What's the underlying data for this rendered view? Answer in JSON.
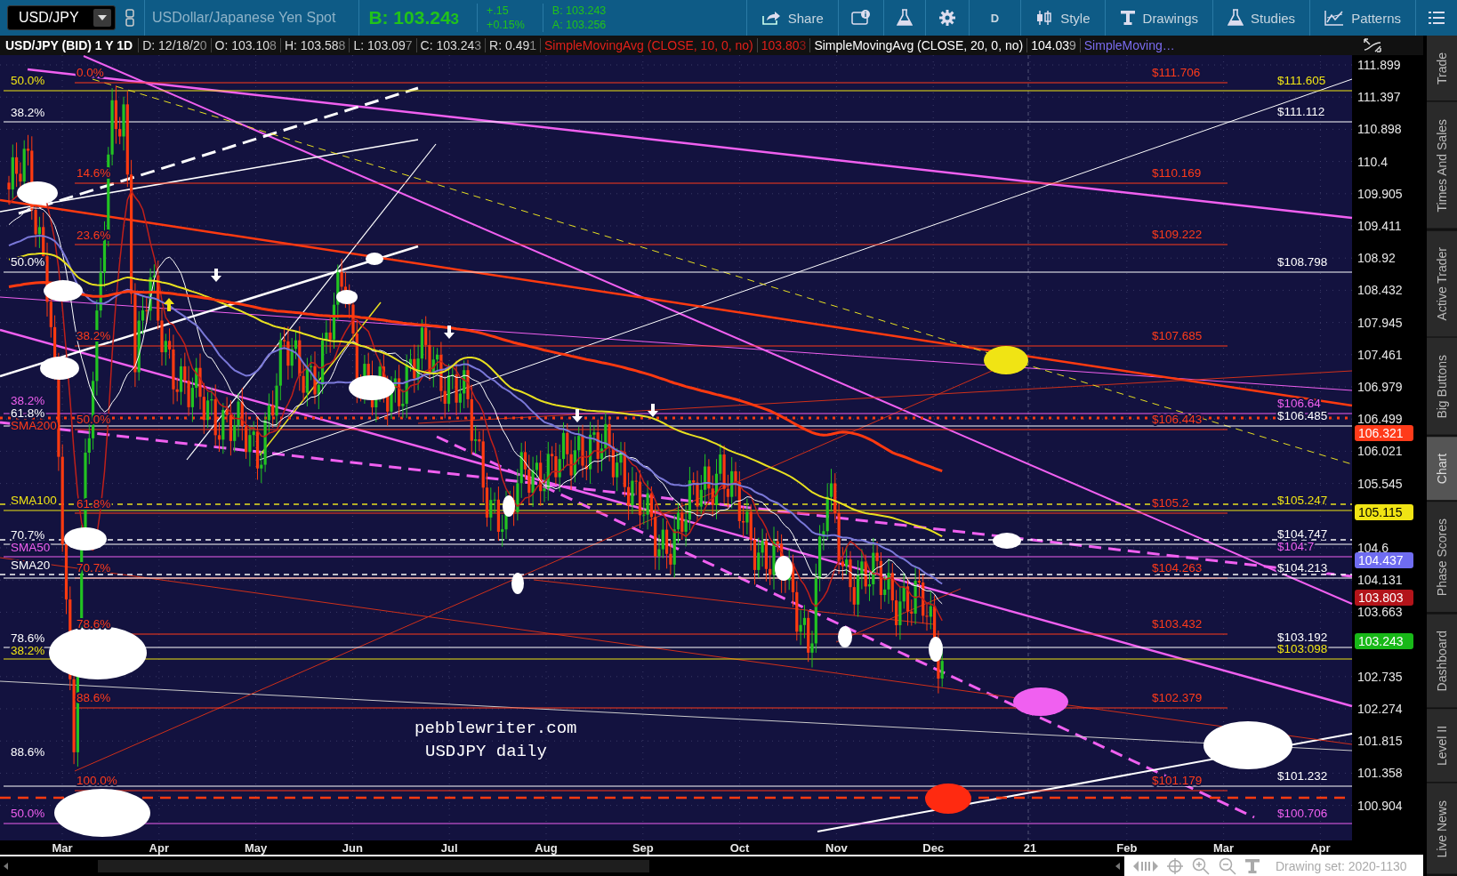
{
  "toolbar": {
    "symbol": "USD/JPY",
    "description": "USDollar/Japanese Yen Spot",
    "bid_big": "B: 103.243",
    "change": "+.15",
    "change_pct": "+0.15%",
    "bid": "B: 103.243",
    "ask": "A: 103.256",
    "buttons": [
      {
        "label": "Share"
      },
      {
        "label": "D"
      },
      {
        "label": "Style"
      },
      {
        "label": "Drawings"
      },
      {
        "label": "Studies"
      },
      {
        "label": "Patterns"
      }
    ]
  },
  "info_bar": {
    "title": "USD/JPY (BID) 1 Y 1D",
    "fields": [
      "D: 12/18/20",
      "O: 103.108",
      "H: 103.588",
      "L: 103.097",
      "C: 103.243",
      "R: 0.491"
    ],
    "studies": [
      {
        "label": "SimpleMovingAvg (CLOSE, 10, 0, no)",
        "value": "103.803",
        "color": "#e0201a"
      },
      {
        "label": "SimpleMovingAvg (CLOSE, 20, 0, no)",
        "value": "104.039",
        "color": "#ffffff"
      },
      {
        "label": "SimpleMoving…",
        "color": "#7b6cf0"
      }
    ]
  },
  "chart": {
    "level_labels": [
      {
        "text": "$111.706",
        "color": "#ff3b1a",
        "kind": "fib_level"
      },
      {
        "text": "$111.605",
        "color": "#f0e414",
        "kind": "line_level"
      },
      {
        "text": "$111.112",
        "color": "#ffffff",
        "kind": "line_level"
      },
      {
        "text": "$110.169",
        "color": "#ff3b1a",
        "kind": "fib_level"
      },
      {
        "text": "$109.222",
        "color": "#ff3b1a",
        "kind": "fib_level"
      },
      {
        "text": "$108.798",
        "color": "#ffffff",
        "kind": "line_level"
      },
      {
        "text": "$107.685",
        "color": "#ff3b1a",
        "kind": "fib_level"
      },
      {
        "text": "$106.64",
        "color": "#f060f0",
        "kind": "line_level"
      },
      {
        "text": "$106.443",
        "color": "#ff3b1a",
        "kind": "fib_level"
      },
      {
        "text": "$106.485",
        "color": "#ffffff",
        "kind": "line_level"
      },
      {
        "text": "$105.2",
        "color": "#ff3b1a",
        "kind": "fib_level"
      },
      {
        "text": "$105.247",
        "color": "#f0e414",
        "kind": "line_level"
      },
      {
        "text": "$104.747",
        "color": "#ffffff",
        "kind": "line_level"
      },
      {
        "text": "$104.7",
        "color": "#f060f0",
        "kind": "line_level"
      },
      {
        "text": "$104.263",
        "color": "#ff3b1a",
        "kind": "fib_level"
      },
      {
        "text": "$104.213",
        "color": "#ffffff",
        "kind": "line_level"
      },
      {
        "text": "$103.432",
        "color": "#ff3b1a",
        "kind": "fib_level"
      },
      {
        "text": "$103.192",
        "color": "#ffffff",
        "kind": "line_level"
      },
      {
        "text": "$103.098",
        "color": "#f0e414",
        "kind": "line_level"
      },
      {
        "text": "$102.379",
        "color": "#ff3b1a",
        "kind": "fib_level"
      },
      {
        "text": "$101.179",
        "color": "#ff3b1a",
        "kind": "fib_level"
      },
      {
        "text": "$101.232",
        "color": "#ffffff",
        "kind": "line_level"
      },
      {
        "text": "$100.706",
        "color": "#f060f0",
        "kind": "line_level"
      }
    ],
    "fib_labels": [
      {
        "text": "50.0%",
        "color": "#f0e414",
        "kind": "line_level"
      },
      {
        "text": "0.0%",
        "color": "#ff3b1a",
        "kind": "fib_level"
      },
      {
        "text": "38.2%",
        "color": "#ffffff",
        "kind": "line_level"
      },
      {
        "text": "14.6%",
        "color": "#ff3b1a",
        "kind": "fib_level"
      },
      {
        "text": "23.6%",
        "color": "#ff3b1a",
        "kind": "fib_level"
      },
      {
        "text": "50.0%",
        "color": "#ffffff",
        "kind": "line_level"
      },
      {
        "text": "38.2%",
        "color": "#ff3b1a",
        "kind": "fib_level"
      },
      {
        "text": "38.2%",
        "color": "#f060f0",
        "kind": "line_level"
      },
      {
        "text": "61.8%",
        "color": "#ffffff",
        "kind": "line_level"
      },
      {
        "text": "SMA200",
        "color": "#ff3b1a",
        "kind": "study"
      },
      {
        "text": "50.0%",
        "color": "#ff3b1a",
        "kind": "fib_level"
      },
      {
        "text": "SMA100",
        "color": "#f0e414",
        "kind": "study"
      },
      {
        "text": "61.8%",
        "color": "#ff3b1a",
        "kind": "fib_level"
      },
      {
        "text": "70.7%",
        "color": "#ffffff",
        "kind": "line_level"
      },
      {
        "text": "SMA50",
        "color": "#f060f0",
        "kind": "study"
      },
      {
        "text": "70.7%",
        "color": "#ff3b1a",
        "kind": "fib_level"
      },
      {
        "text": "SMA20",
        "color": "#ffffff",
        "kind": "study"
      },
      {
        "text": "78.6%",
        "color": "#ff3b1a",
        "kind": "fib_level"
      },
      {
        "text": "78.6%",
        "color": "#ffffff",
        "kind": "line_level"
      },
      {
        "text": "38.2%",
        "color": "#f0e414",
        "kind": "line_level"
      },
      {
        "text": "88.6%",
        "color": "#ff3b1a",
        "kind": "fib_level"
      },
      {
        "text": "88.6%",
        "color": "#ffffff",
        "kind": "line_level"
      },
      {
        "text": "100.0%",
        "color": "#ff3b1a",
        "kind": "fib_level"
      },
      {
        "text": "50.0%",
        "color": "#f060f0",
        "kind": "line_level"
      }
    ],
    "note": [
      "pebblewriter.com",
      "USDJPY daily"
    ],
    "price_axis": [
      "111.899",
      "111.397",
      "110.898",
      "110.4",
      "109.905",
      "109.411",
      "108.92",
      "108.432",
      "107.945",
      "107.461",
      "106.979",
      "106.499",
      "106.021",
      "105.545",
      "104.6",
      "104.131",
      "103.663",
      "102.735",
      "102.274",
      "101.815",
      "101.358",
      "100.904"
    ],
    "price_badges": [
      {
        "text": "106.321",
        "color": "#ff3b1a"
      },
      {
        "text": "105.115",
        "color": "#f0e414"
      },
      {
        "text": "104.437",
        "color": "#6f6cf0"
      },
      {
        "text": "103.803",
        "color": "#b3141a"
      },
      {
        "text": "103.243",
        "color": "#18b818"
      }
    ],
    "months": [
      "Mar",
      "Apr",
      "May",
      "Jun",
      "Jul",
      "Aug",
      "Sep",
      "Oct",
      "Nov",
      "Dec",
      "21",
      "Feb",
      "Mar",
      "Apr"
    ]
  },
  "bottom_bar": {
    "drawing_set": "Drawing set: 2020-1130"
  },
  "side_tabs": [
    {
      "label": "Trade",
      "selected": false
    },
    {
      "label": "Times And Sales",
      "selected": false
    },
    {
      "label": "Active Trader",
      "selected": false
    },
    {
      "label": "Big Buttons",
      "selected": false
    },
    {
      "label": "Chart",
      "selected": true
    },
    {
      "label": "Phase Scores",
      "selected": false
    },
    {
      "label": "Dashboard",
      "selected": false
    },
    {
      "label": "Level II",
      "selected": false
    },
    {
      "label": "Live News",
      "selected": false
    }
  ]
}
